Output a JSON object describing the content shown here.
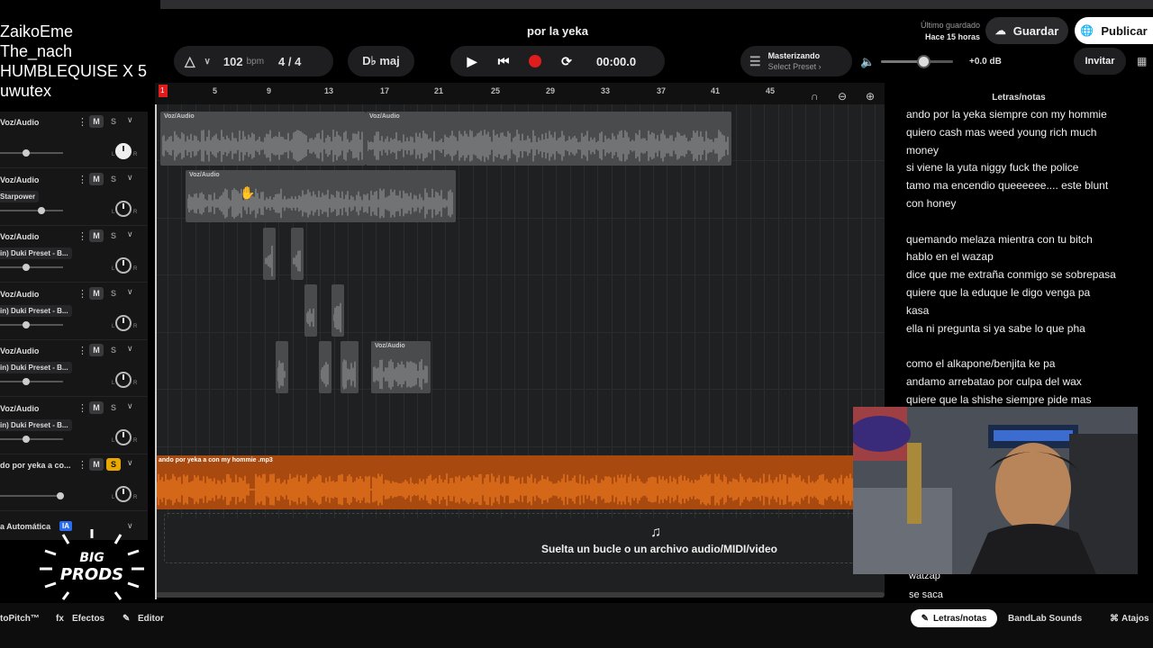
{
  "overlay": {
    "names": [
      "ZaikoEme",
      "The_nach",
      "HUMBLEQUISE X 5",
      "uwutex"
    ]
  },
  "header": {
    "song_title": "por la yeka",
    "bpm_value": "102",
    "bpm_unit": "bpm",
    "time_signature": "4 / 4",
    "key": "D♭ maj",
    "time": "00:00.0",
    "mastering_title": "Masterizando",
    "mastering_preset": "Select Preset ›",
    "gain": "+0.0 dB",
    "volume_fraction": 0.6,
    "saved_label": "Último guardado",
    "saved_time": "Hace 15 horas",
    "save_button": "Guardar",
    "publish_button": "Publicar",
    "invite_button": "Invitar",
    "icons": {
      "metronome": "metronome-icon",
      "play": "play-icon",
      "rewind": "skip-back-icon",
      "record": "record-icon",
      "loop": "loop-icon",
      "volume": "speaker-icon",
      "cloud": "cloud-upload-icon",
      "globe": "globe-icon"
    }
  },
  "ruler": {
    "marks": [
      "1",
      "5",
      "9",
      "13",
      "17",
      "21",
      "25",
      "29",
      "33",
      "37",
      "41",
      "45"
    ]
  },
  "tracks": [
    {
      "name": "Voz/Audio",
      "preset": "",
      "solo": false,
      "fader": 0.42,
      "knob_white": true
    },
    {
      "name": "Voz/Audio",
      "preset": "Starpower",
      "solo": false,
      "fader": 0.65,
      "knob_white": false
    },
    {
      "name": "Voz/Audio",
      "preset": "in) Duki Preset - B...",
      "solo": false,
      "fader": 0.42,
      "knob_white": false
    },
    {
      "name": "Voz/Audio",
      "preset": "in) Duki Preset - B...",
      "solo": false,
      "fader": 0.42,
      "knob_white": false
    },
    {
      "name": "Voz/Audio",
      "preset": "in) Duki Preset - B...",
      "solo": false,
      "fader": 0.42,
      "knob_white": false
    },
    {
      "name": "Voz/Audio",
      "preset": "in) Duki Preset - B...",
      "solo": false,
      "fader": 0.42,
      "knob_white": false
    },
    {
      "name": "do por yeka a co...",
      "preset": "",
      "solo": true,
      "fader": 0.95,
      "knob_white": false
    }
  ],
  "track_buttons": {
    "mute": "M",
    "solo": "S"
  },
  "automation": {
    "label": "a Automática",
    "badge": "IA"
  },
  "clips": {
    "voz_label": "Voz/Audio",
    "beat_label": "ando por yeka a con my hommie .mp3"
  },
  "drop_zone": {
    "text": "Suelta un bucle o un archivo audio/MIDI/video"
  },
  "notes": {
    "title": "Letras/notas",
    "lines": [
      " ando por la  yeka siempre con my hommie",
      "quiero cash mas weed  young rich  much",
      "money",
      "si viene la yuta niggy fuck the police",
      " tamo ma encendio queeeeee.... este blunt",
      "con honey",
      "",
      "quemando melaza mientra con tu bitch",
      "hablo en el wazap",
      "dice que me extraña conmigo se sobrepasa",
      " quiere que la eduque le digo venga pa",
      "kasa",
      "ella ni pregunta si ya sabe lo que pha",
      "",
      " como el alkapone/benjita ke pa",
      "andamo arrebatao por culpa del wax",
      "quiere que la shishe siempre pide mas"
    ],
    "tail": [
      "watzap",
      "se saca"
    ]
  },
  "bottom": {
    "autopitch": "toPitch™",
    "effects": "Efectos",
    "editor": "Editor",
    "lyrics_tab": "Letras/notas",
    "sounds_tab": "BandLab Sounds",
    "shortcuts_tab": "Atajos"
  },
  "logo": {
    "line1": "BIG",
    "line2": "PRODS"
  },
  "colors": {
    "record": "#e01c1c",
    "solo": "#e8a800",
    "beat_track": "#e8741c",
    "accent_ia": "#2a6cf0"
  }
}
